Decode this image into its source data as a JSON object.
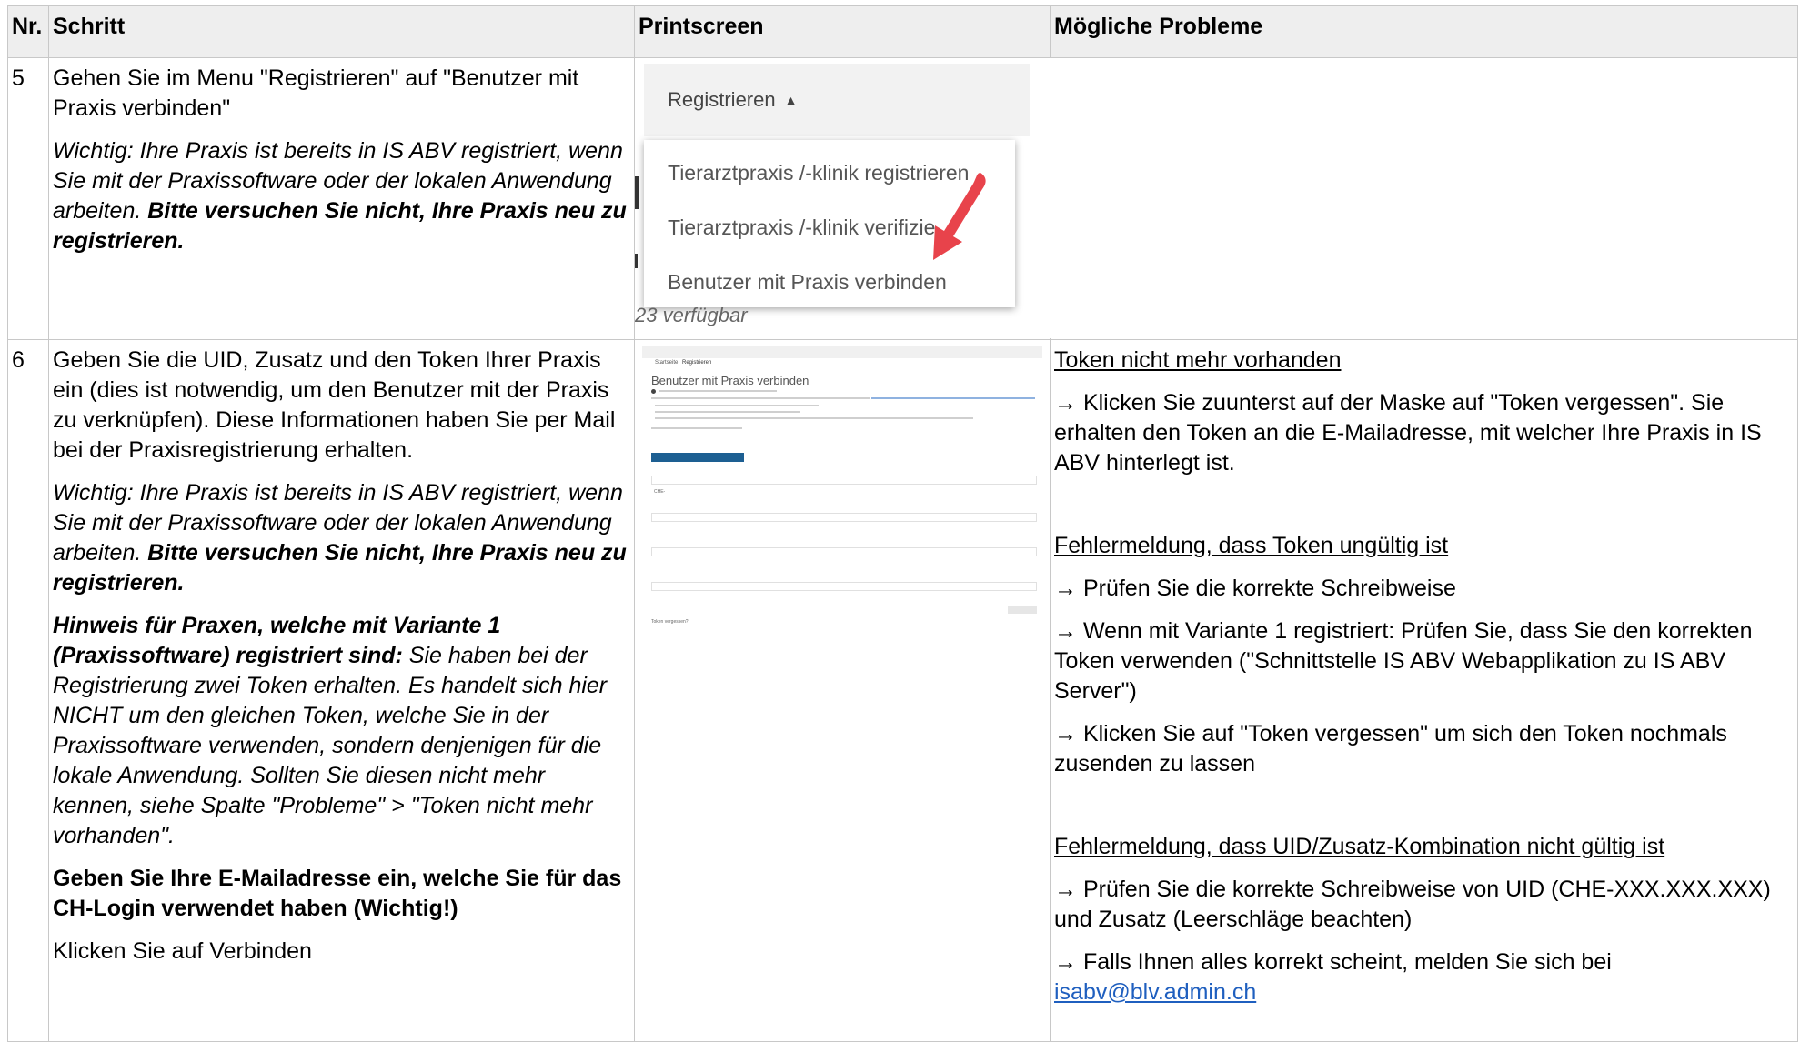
{
  "table": {
    "headers": {
      "nr": "Nr.",
      "step": "Schritt",
      "printscreen": "Printscreen",
      "problems": "Mögliche Probleme"
    },
    "row5": {
      "nr": "5",
      "step_p1": "Gehen Sie  im Menu \"Registrieren\" auf \"Benutzer mit Praxis verbinden\"",
      "step_p2_italic": "Wichtig: Ihre Praxis ist bereits in IS ABV registriert, wenn Sie mit der Praxissoftware oder der lokalen Anwendung arbeiten. ",
      "step_p2_bold": "Bitte versuchen Sie nicht, Ihre Praxis neu zu registrieren.",
      "screenshot": {
        "menu_title": "Registrieren",
        "items": [
          "Tierarztpraxis /-klinik registrieren",
          "Tierarztpraxis /-klinik verifizie",
          "Benutzer mit Praxis verbinden"
        ],
        "background_fragment": "23 verfügbar"
      }
    },
    "row6": {
      "nr": "6",
      "step_p1": "Geben Sie die UID, Zusatz und den Token Ihrer Praxis ein (dies ist notwendig, um den Benutzer mit der Praxis zu verknüpfen). Diese Informationen haben Sie per Mail bei der Praxisregistrierung erhalten.",
      "step_p2_italic": "Wichtig: Ihre Praxis ist bereits in IS ABV registriert, wenn Sie mit der Praxissoftware oder der lokalen Anwendung arbeiten. ",
      "step_p2_bold": "Bitte versuchen Sie nicht, Ihre Praxis neu zu registrieren.",
      "step_p3_bold": "Hinweis für Praxen, welche mit Variante 1 (Praxissoftware) registriert sind:",
      "step_p3_italic": " Sie haben bei der Registrierung zwei Token erhalten. Es handelt sich hier NICHT um den gleichen Token, welche Sie in der Praxissoftware verwenden, sondern denjenigen für die lokale Anwendung. Sollten Sie diesen nicht mehr kennen, siehe Spalte \"Probleme\" > \"Token nicht mehr vorhanden\".",
      "step_p4_bold": "Geben Sie Ihre E-Mailadresse ein, welche Sie für das CH-Login verwendet haben (Wichtig!)",
      "step_p5": "Klicken Sie auf Verbinden",
      "screenshot": {
        "tab1": "Startseite",
        "tab2": "Registrieren",
        "title": "Benutzer mit Praxis verbinden",
        "labels": [
          "UID Nr.",
          "Zusatz",
          "Token",
          "E-Mail (Benutzer)"
        ],
        "uid_prefix": "CHE-",
        "forgot": "Token vergessen?"
      },
      "problems": {
        "h1": "Token nicht mehr vorhanden",
        "h1_p1": "→ Klicken Sie zuunterst auf  der Maske auf \"Token vergessen\". Sie erhalten den Token an die E-Mailadresse, mit welcher Ihre Praxis in IS ABV hinterlegt ist.",
        "h2": "Fehlermeldung, dass Token ungültig ist",
        "h2_p1": "→ Prüfen Sie die korrekte Schreibweise",
        "h2_p2": "→ Wenn mit Variante 1 registriert: Prüfen Sie, dass Sie den korrekten Token verwenden (\"Schnittstelle IS ABV Webapplikation zu IS ABV Server\")",
        "h2_p3": "→ Klicken Sie auf \"Token vergessen\" um sich den Token nochmals zusenden zu lassen",
        "h3": "Fehlermeldung, dass UID/Zusatz-Kombination nicht gültig ist",
        "h3_p1": "→ Prüfen Sie die korrekte Schreibweise von UID (CHE-XXX.XXX.XXX) und Zusatz (Leerschläge beachten)",
        "h3_p2": "→ Falls Ihnen alles korrekt scheint, melden Sie sich bei ",
        "email": "isabv@blv.admin.ch"
      }
    }
  },
  "colors": {
    "header_bg": "#eeeeee",
    "border": "#c8c8c8",
    "link": "#1f5fbf",
    "arrow": "#e8434b",
    "button": "#1d5f92"
  }
}
